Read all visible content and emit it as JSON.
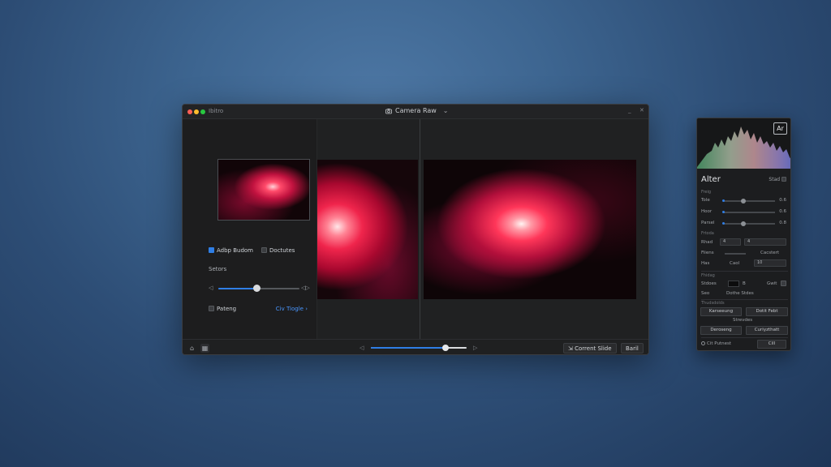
{
  "window": {
    "app_name": "Ibitro",
    "title": "Camera Raw",
    "title_chevron": "⌄",
    "minimize": "_",
    "close": "✕"
  },
  "sidebar": {
    "checkbox_1": "Adbp Budom",
    "checkbox_2": "Doctutes",
    "section_label": "Setors",
    "slider_left_icon": "◁",
    "slider_right_icon": "◁▷",
    "slider_value": 0.47,
    "footer_left": "Pateng",
    "footer_right": "Civ Tiogle",
    "footer_right_chevron": "›"
  },
  "bottombar": {
    "left_icon": "⌂",
    "second_icon": "▦",
    "slider_left": "◁",
    "slider_right": "▷",
    "slider_value": 0.78,
    "btn_compare": "Corrent Slide",
    "btn_compare_icon": "⇲",
    "btn_back": "Baril"
  },
  "panel": {
    "badge": "Ar",
    "title": "Alter",
    "title_right": "Stad",
    "section1_head": "Freig",
    "sliders": [
      {
        "label": "Tole",
        "value_text": "0.6",
        "knob": 0.39,
        "fill": 0.0
      },
      {
        "label": "Hoor",
        "value_text": "0.6",
        "knob": 0.0,
        "fill": 0.0
      },
      {
        "label": "Parsel",
        "value_text": "0.8",
        "knob": 0.39,
        "fill": 0.0
      }
    ],
    "section2_head": "Frtoda",
    "row_shad": {
      "label": "Rhad",
      "select1": "4",
      "select2": "4"
    },
    "row_fiiens": {
      "label": "Fiiens",
      "right": "Cacstert"
    },
    "row_has": {
      "label": "Has",
      "mid": "Caol",
      "select": "10"
    },
    "section3_head": "Fhidag",
    "row_stdes": {
      "label": "Stdoes",
      "mid": "B",
      "right": "Gwit"
    },
    "row_seo": {
      "label": "Seo",
      "right": "Dothe Stdes"
    },
    "section4_head": "Thudsdolds",
    "btn_r1_left": "Karseeung",
    "btn_r1_right": "Dotit Febt",
    "mid_label": "Strevdes",
    "btn_r2_left": "Deroseng",
    "btn_r2_right": "Curiyzthatt",
    "footer_left": "Cit Putnest",
    "footer_btn": "Cill"
  }
}
